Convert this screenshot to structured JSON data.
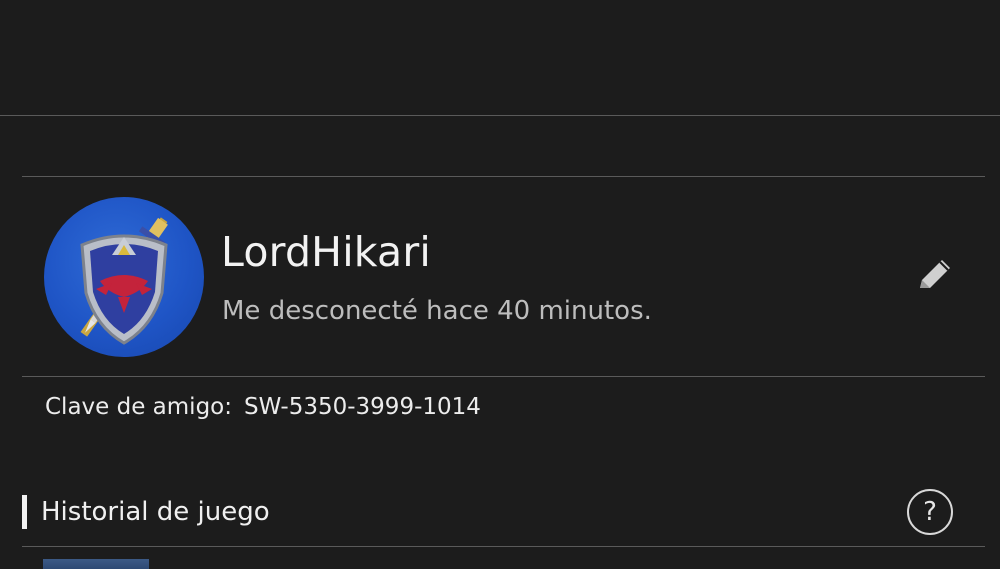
{
  "profile": {
    "username": "LordHikari",
    "status": "Me desconecté hace 40 minutos.",
    "avatar_icon": "hylian-shield-icon",
    "avatar_color": "#1f55c6"
  },
  "friend_code": {
    "label": "Clave de amigo:",
    "value": "SW-5350-3999-1014"
  },
  "play_history": {
    "title": "Historial de juego",
    "help_label": "?"
  },
  "icons": {
    "edit": "pencil-icon",
    "help": "question-mark-icon"
  },
  "colors": {
    "background": "#1c1c1c",
    "divider": "#5a5a5a",
    "text_primary": "#f2f2f2",
    "text_secondary": "#bdbdbd"
  }
}
